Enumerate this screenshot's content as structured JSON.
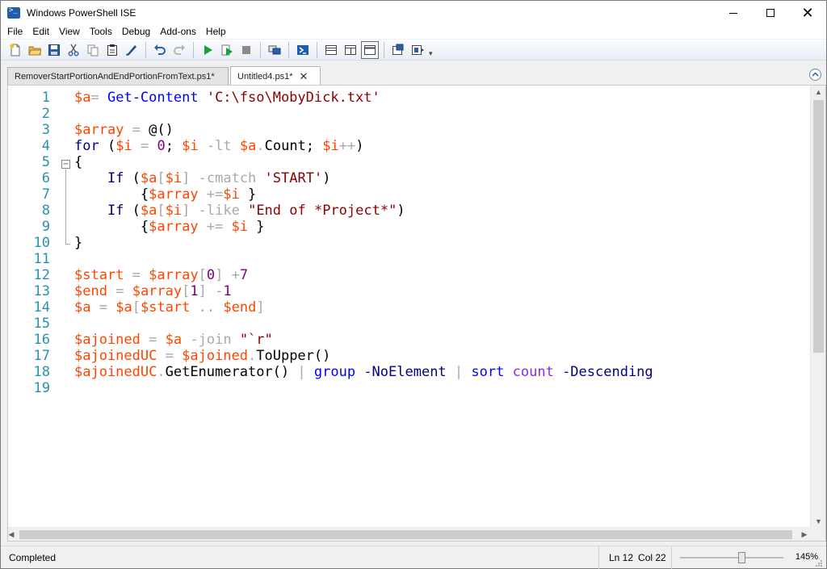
{
  "window": {
    "title": "Windows PowerShell ISE"
  },
  "menu": [
    "File",
    "Edit",
    "View",
    "Tools",
    "Debug",
    "Add-ons",
    "Help"
  ],
  "toolbar": {
    "buttons": [
      "new-icon",
      "open-icon",
      "save-icon",
      "cut-icon",
      "copy-icon",
      "paste-icon",
      "clear-console-icon",
      "undo-icon",
      "redo-icon",
      "run-script-icon",
      "run-selection-icon",
      "stop-icon",
      "remote-powershell-icon",
      "powershell-console-icon",
      "show-script-pane-top-icon",
      "show-script-pane-right-icon",
      "show-script-pane-maximized-icon",
      "show-command-window-icon",
      "show-command-addon-icon"
    ]
  },
  "tabs": [
    {
      "label": "RemoverStartPortionAndEndPortionFromText.ps1*",
      "active": false
    },
    {
      "label": "Untitled4.ps1*",
      "active": true,
      "close": "✕"
    }
  ],
  "editor": {
    "lines": [
      {
        "n": "1",
        "tokens": [
          [
            "v",
            "$a"
          ],
          [
            "o",
            "="
          ],
          [
            "p",
            " "
          ],
          [
            "c",
            "Get-Content"
          ],
          [
            "p",
            " "
          ],
          [
            "s",
            "'C:\\fso\\MobyDick.txt'"
          ]
        ]
      },
      {
        "n": "2",
        "tokens": []
      },
      {
        "n": "3",
        "tokens": [
          [
            "v",
            "$array"
          ],
          [
            "p",
            " "
          ],
          [
            "o",
            "="
          ],
          [
            "p",
            " "
          ],
          [
            "m",
            "@()"
          ]
        ]
      },
      {
        "n": "4",
        "tokens": [
          [
            "cp",
            "for"
          ],
          [
            "p",
            " ("
          ],
          [
            "v",
            "$i"
          ],
          [
            "p",
            " "
          ],
          [
            "o",
            "="
          ],
          [
            "p",
            " "
          ],
          [
            "n",
            "0"
          ],
          [
            "p",
            "; "
          ],
          [
            "v",
            "$i"
          ],
          [
            "p",
            " "
          ],
          [
            "o",
            "-lt"
          ],
          [
            "p",
            " "
          ],
          [
            "v",
            "$a"
          ],
          [
            "o",
            "."
          ],
          [
            "p",
            "Count; "
          ],
          [
            "v",
            "$i"
          ],
          [
            "o",
            "++"
          ],
          [
            "p",
            ")"
          ]
        ]
      },
      {
        "n": "5",
        "tokens": [
          [
            "p",
            "{"
          ]
        ]
      },
      {
        "n": "6",
        "tokens": [
          [
            "p",
            "    "
          ],
          [
            "cp",
            "If"
          ],
          [
            "p",
            " ("
          ],
          [
            "v",
            "$a"
          ],
          [
            "o",
            "["
          ],
          [
            "v",
            "$i"
          ],
          [
            "o",
            "]"
          ],
          [
            "p",
            " "
          ],
          [
            "o",
            "-cmatch"
          ],
          [
            "p",
            " "
          ],
          [
            "s",
            "'START'"
          ],
          [
            "p",
            ")"
          ]
        ]
      },
      {
        "n": "7",
        "tokens": [
          [
            "p",
            "        {"
          ],
          [
            "v",
            "$array"
          ],
          [
            "p",
            " "
          ],
          [
            "o",
            "+="
          ],
          [
            "v",
            "$i"
          ],
          [
            "p",
            " }"
          ]
        ]
      },
      {
        "n": "8",
        "tokens": [
          [
            "p",
            "    "
          ],
          [
            "cp",
            "If"
          ],
          [
            "p",
            " ("
          ],
          [
            "v",
            "$a"
          ],
          [
            "o",
            "["
          ],
          [
            "v",
            "$i"
          ],
          [
            "o",
            "]"
          ],
          [
            "p",
            " "
          ],
          [
            "o",
            "-like"
          ],
          [
            "p",
            " "
          ],
          [
            "s",
            "\"End of *Project*\""
          ],
          [
            "p",
            ")"
          ]
        ]
      },
      {
        "n": "9",
        "tokens": [
          [
            "p",
            "        {"
          ],
          [
            "v",
            "$array"
          ],
          [
            "p",
            " "
          ],
          [
            "o",
            "+="
          ],
          [
            "p",
            " "
          ],
          [
            "v",
            "$i"
          ],
          [
            "p",
            " }"
          ]
        ]
      },
      {
        "n": "10",
        "tokens": [
          [
            "p",
            "}"
          ]
        ]
      },
      {
        "n": "11",
        "tokens": []
      },
      {
        "n": "12",
        "tokens": [
          [
            "v",
            "$start"
          ],
          [
            "p",
            " "
          ],
          [
            "o",
            "="
          ],
          [
            "p",
            " "
          ],
          [
            "v",
            "$array"
          ],
          [
            "o",
            "["
          ],
          [
            "n",
            "0"
          ],
          [
            "o",
            "]"
          ],
          [
            "p",
            " "
          ],
          [
            "o",
            "+"
          ],
          [
            "n",
            "7"
          ]
        ]
      },
      {
        "n": "13",
        "tokens": [
          [
            "v",
            "$end"
          ],
          [
            "p",
            " "
          ],
          [
            "o",
            "="
          ],
          [
            "p",
            " "
          ],
          [
            "v",
            "$array"
          ],
          [
            "o",
            "["
          ],
          [
            "n",
            "1"
          ],
          [
            "o",
            "]"
          ],
          [
            "p",
            " "
          ],
          [
            "o",
            "-"
          ],
          [
            "n",
            "1"
          ]
        ]
      },
      {
        "n": "14",
        "tokens": [
          [
            "v",
            "$a"
          ],
          [
            "p",
            " "
          ],
          [
            "o",
            "="
          ],
          [
            "p",
            " "
          ],
          [
            "v",
            "$a"
          ],
          [
            "o",
            "["
          ],
          [
            "v",
            "$start"
          ],
          [
            "p",
            " "
          ],
          [
            "o",
            ".."
          ],
          [
            "p",
            " "
          ],
          [
            "v",
            "$end"
          ],
          [
            "o",
            "]"
          ]
        ]
      },
      {
        "n": "15",
        "tokens": []
      },
      {
        "n": "16",
        "tokens": [
          [
            "v",
            "$ajoined"
          ],
          [
            "p",
            " "
          ],
          [
            "o",
            "="
          ],
          [
            "p",
            " "
          ],
          [
            "v",
            "$a"
          ],
          [
            "p",
            " "
          ],
          [
            "o",
            "-join"
          ],
          [
            "p",
            " "
          ],
          [
            "s",
            "\"`r\""
          ]
        ]
      },
      {
        "n": "17",
        "tokens": [
          [
            "v",
            "$ajoinedUC"
          ],
          [
            "p",
            " "
          ],
          [
            "o",
            "="
          ],
          [
            "p",
            " "
          ],
          [
            "v",
            "$ajoined"
          ],
          [
            "o",
            "."
          ],
          [
            "p",
            "ToUpper()"
          ]
        ]
      },
      {
        "n": "18",
        "tokens": [
          [
            "v",
            "$ajoinedUC"
          ],
          [
            "o",
            "."
          ],
          [
            "p",
            "GetEnumerator() "
          ],
          [
            "o",
            "|"
          ],
          [
            "p",
            " "
          ],
          [
            "c",
            "group"
          ],
          [
            "p",
            " "
          ],
          [
            "cp",
            "-NoElement"
          ],
          [
            "p",
            " "
          ],
          [
            "o",
            "|"
          ],
          [
            "p",
            " "
          ],
          [
            "c",
            "sort"
          ],
          [
            "p",
            " "
          ],
          [
            "t",
            "count"
          ],
          [
            "p",
            " "
          ],
          [
            "cp",
            "-Descending"
          ]
        ]
      },
      {
        "n": "19",
        "tokens": []
      }
    ]
  },
  "status": {
    "text": "Completed",
    "line": "Ln 12",
    "col": "Col 22",
    "zoom": "145%",
    "zoom_level": 0.59
  }
}
